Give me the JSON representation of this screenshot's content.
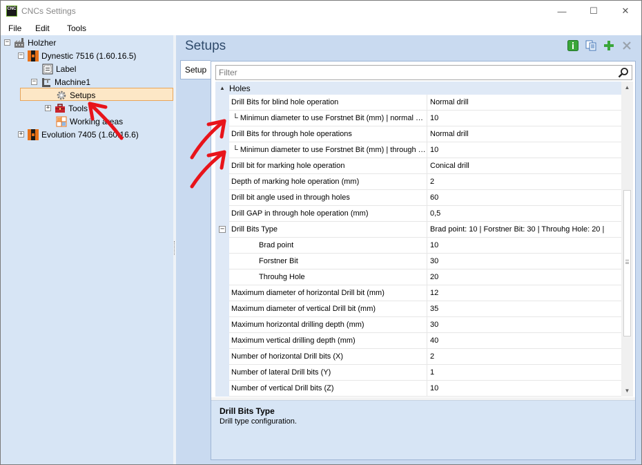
{
  "window": {
    "title": "CNCs Settings",
    "app_icon_text": "CNC",
    "minimize": "—",
    "maximize": "☐",
    "close": "✕"
  },
  "menu": {
    "file": "File",
    "edit": "Edit",
    "tools": "Tools"
  },
  "tree": {
    "root": "Holzher",
    "dynestic": "Dynestic 7516 (1.60.16.5)",
    "label": "Label",
    "machine": "Machine1",
    "setups": "Setups",
    "tools": "Tools",
    "working_areas": "Working areas",
    "evolution": "Evolution 7405 (1.60.16.6)"
  },
  "header": {
    "title": "Setups"
  },
  "tab": {
    "setup": "Setup"
  },
  "filter": {
    "placeholder": "Filter"
  },
  "grid": {
    "group": "Holes",
    "rows": [
      {
        "name": "Drill Bits for blind hole operation",
        "value": "Normal drill"
      },
      {
        "name": "└ Minimun diameter to use Forstnet Bit (mm) | normal drill",
        "value": "10"
      },
      {
        "name": "Drill Bits for through hole operations",
        "value": "Normal drill"
      },
      {
        "name": "└ Minimun diameter to use Forstnet Bit (mm) | through hole",
        "value": "10"
      },
      {
        "name": "Drill bit for marking hole operation",
        "value": "Conical drill"
      },
      {
        "name": "Depth of marking hole operation (mm)",
        "value": "2"
      },
      {
        "name": "Drill bit angle used in through holes",
        "value": "60"
      },
      {
        "name": "Drill GAP in through hole operation (mm)",
        "value": "0,5"
      },
      {
        "name": "Drill Bits Type",
        "value": "Brad point: 10  |  Forstner Bit: 30  |  Throuhg Hole: 20  |"
      },
      {
        "name": "Brad point",
        "value": "10"
      },
      {
        "name": "Forstner Bit",
        "value": "30"
      },
      {
        "name": "Throuhg Hole",
        "value": "20"
      },
      {
        "name": "Maximum diameter of horizontal Drill bit (mm)",
        "value": "12"
      },
      {
        "name": "Maximum diameter of vertical Drill bit (mm)",
        "value": "35"
      },
      {
        "name": "Maximum horizontal drilling depth (mm)",
        "value": "30"
      },
      {
        "name": "Maximum vertical drilling depth (mm)",
        "value": "40"
      },
      {
        "name": "Number of horizontal Drill bits (X)",
        "value": "2"
      },
      {
        "name": "Number of lateral Drill bits (Y)",
        "value": "1"
      },
      {
        "name": "Number of vertical Drill bits (Z)",
        "value": "10"
      }
    ]
  },
  "description": {
    "title": "Drill Bits Type",
    "text": "Drill type configuration."
  },
  "colors": {
    "pane_bg": "#d7e5f5",
    "selection": "#fde7c6",
    "accent_green": "#3aa63a",
    "annotation_red": "#e8141b"
  }
}
